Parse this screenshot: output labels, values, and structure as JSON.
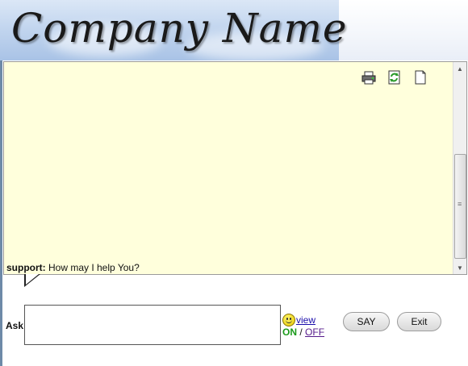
{
  "header": {
    "logo_text": "Company Name"
  },
  "toolbar": {
    "icons": [
      "print-icon",
      "refresh-icon",
      "page-icon"
    ]
  },
  "chat": {
    "messages": [
      {
        "sender": "support:",
        "text": "How may I help You?"
      }
    ]
  },
  "input": {
    "ask_label": "Ask",
    "value": "",
    "smiley_view": "view",
    "on_label": "ON",
    "separator": "/",
    "off_label": "OFF"
  },
  "buttons": {
    "say": "SAY",
    "exit": "Exit"
  }
}
